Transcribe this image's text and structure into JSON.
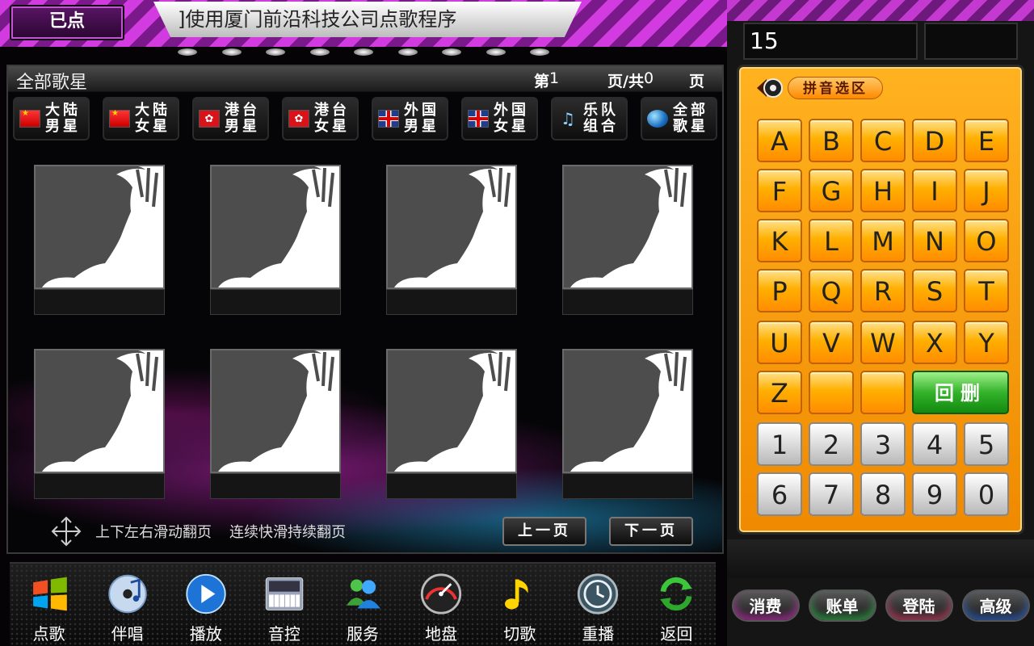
{
  "header": {
    "already_button": "已点",
    "marquee": "]使用厦门前沿科技公司点歌程序"
  },
  "main": {
    "title": "全部歌星",
    "page": {
      "prefix": "第",
      "current": "1",
      "mid": "页/共",
      "total": "0",
      "suffix": "页"
    },
    "categories": [
      {
        "label": "大陆男星",
        "icon": "china-flag-icon"
      },
      {
        "label": "大陆女星",
        "icon": "china-flag-icon"
      },
      {
        "label": "港台男星",
        "icon": "hongkong-flag-icon"
      },
      {
        "label": "港台女星",
        "icon": "hongkong-flag-icon"
      },
      {
        "label": "外国男星",
        "icon": "uk-flag-icon"
      },
      {
        "label": "外国女星",
        "icon": "uk-flag-icon"
      },
      {
        "label": "乐队组合",
        "icon": "band-icon"
      },
      {
        "label": "全部歌星",
        "icon": "globe-icon"
      }
    ],
    "hint_1": "上下左右滑动翻页",
    "hint_2": "连续快滑持续翻页",
    "prev_page": "上一页",
    "next_page": "下一页"
  },
  "toolbar": [
    {
      "label": "点歌",
      "icon": "windows-logo-icon"
    },
    {
      "label": "伴唱",
      "icon": "music-cd-icon"
    },
    {
      "label": "播放",
      "icon": "play-icon"
    },
    {
      "label": "音控",
      "icon": "mixer-keyboard-icon"
    },
    {
      "label": "服务",
      "icon": "people-icon"
    },
    {
      "label": "地盘",
      "icon": "speedometer-icon"
    },
    {
      "label": "切歌",
      "icon": "music-note-icon"
    },
    {
      "label": "重播",
      "icon": "replay-clock-icon"
    },
    {
      "label": "返回",
      "icon": "refresh-arrows-icon"
    }
  ],
  "right": {
    "input_value": "15",
    "pinyin_label": "拼音选区",
    "letters": [
      "A",
      "B",
      "C",
      "D",
      "E",
      "F",
      "G",
      "H",
      "I",
      "J",
      "K",
      "L",
      "M",
      "N",
      "O",
      "P",
      "Q",
      "R",
      "S",
      "T",
      "U",
      "V",
      "W",
      "X",
      "Y",
      "Z"
    ],
    "backspace": "回删",
    "numbers": [
      "1",
      "2",
      "3",
      "4",
      "5",
      "6",
      "7",
      "8",
      "9",
      "0"
    ],
    "account_buttons": [
      "消费",
      "账单",
      "登陆",
      "高级"
    ]
  },
  "colors": {
    "accent_magenta": "#c43ad0",
    "keypad_orange": "#ffa000",
    "backspace_green": "#33b22a"
  }
}
